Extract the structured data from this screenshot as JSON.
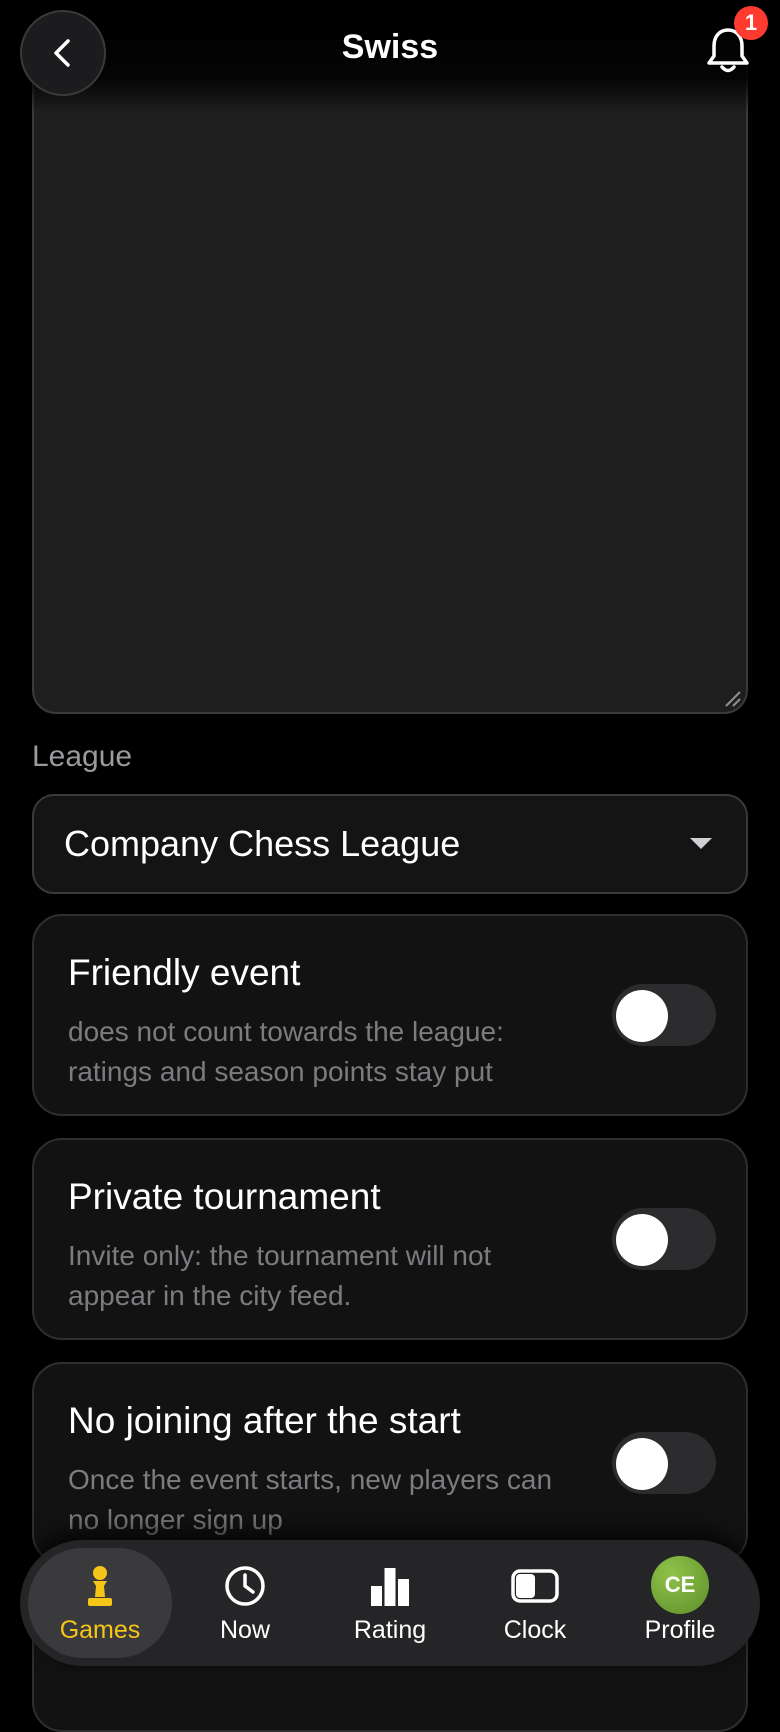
{
  "header": {
    "title": "Swiss",
    "notification_count": "1",
    "back_icon": "chevron-left-icon",
    "bell_icon": "bell-icon"
  },
  "description_field": {
    "value": ""
  },
  "league": {
    "label": "League",
    "selected": "Company Chess League"
  },
  "options": [
    {
      "title": "Friendly event",
      "description": "does not count towards the league: ratings and season points stay put",
      "enabled": false
    },
    {
      "title": "Private tournament",
      "description": "Invite only: the tournament will not appear in the city feed.",
      "enabled": false
    },
    {
      "title": "No joining after the start",
      "description": "Once the event starts, new players can no longer sign up",
      "enabled": false
    }
  ],
  "bottom_nav": {
    "items": [
      {
        "label": "Games",
        "icon": "pawn-icon",
        "active": true
      },
      {
        "label": "Now",
        "icon": "clock-icon",
        "active": false
      },
      {
        "label": "Rating",
        "icon": "bar-chart-icon",
        "active": false
      },
      {
        "label": "Clock",
        "icon": "chess-clock-icon",
        "active": false
      },
      {
        "label": "Profile",
        "icon": "avatar",
        "active": false,
        "initials": "CE"
      }
    ]
  },
  "colors": {
    "accent": "#f5c518",
    "badge": "#ff3b30",
    "avatar": "#6fa33a"
  }
}
